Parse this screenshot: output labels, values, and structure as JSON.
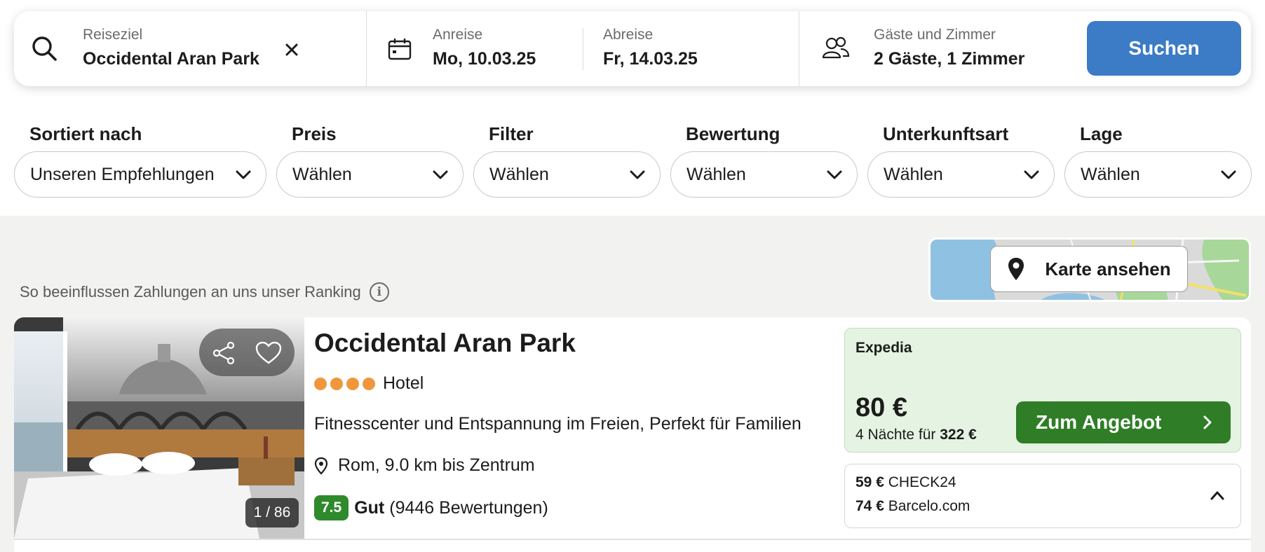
{
  "search": {
    "destination": {
      "label": "Reiseziel",
      "value": "Occidental Aran Park",
      "clear_icon": "close-icon"
    },
    "checkin": {
      "label": "Anreise",
      "value": "Mo, 10.03.25"
    },
    "checkout": {
      "label": "Abreise",
      "value": "Fr, 14.03.25"
    },
    "guests": {
      "label": "Gäste und Zimmer",
      "value": "2 Gäste, 1 Zimmer"
    },
    "button": "Suchen",
    "button_color": "#3c7bc6"
  },
  "filters": [
    {
      "label": "Sortiert nach",
      "value": "Unseren Empfehlungen"
    },
    {
      "label": "Preis",
      "value": "Wählen"
    },
    {
      "label": "Filter",
      "value": "Wählen"
    },
    {
      "label": "Bewertung",
      "value": "Wählen"
    },
    {
      "label": "Unterkunftsart",
      "value": "Wählen"
    },
    {
      "label": "Lage",
      "value": "Wählen"
    }
  ],
  "ranking_note": "So beeinflussen Zahlungen an uns unser Ranking",
  "map": {
    "button": "Karte ansehen"
  },
  "result": {
    "name": "Occidental Aran Park",
    "stars": 4,
    "type": "Hotel",
    "features": "Fitnesscenter und Entspannung im Freien, Perfekt für Familien",
    "location": "Rom, 9.0 km bis Zentrum",
    "rating_score": "7.5",
    "rating_label": "Gut",
    "rating_count": "(9446 Bewertungen)",
    "image_counter": "1 / 86",
    "deal": {
      "provider": "Expedia",
      "price": "80 €",
      "nights_text": "4 Nächte für",
      "total": "322 €",
      "button": "Zum Angebot",
      "button_color": "#2f7d26"
    },
    "other_offers": [
      {
        "price": "59 €",
        "provider": "CHECK24"
      },
      {
        "price": "74 €",
        "provider": "Barcelo.com"
      }
    ]
  }
}
